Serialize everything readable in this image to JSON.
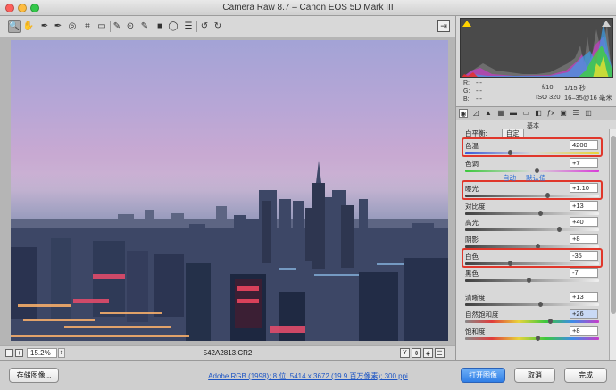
{
  "window": {
    "title": "Camera Raw 8.7 –  Canon EOS 5D Mark III"
  },
  "toolbar": {
    "tools": [
      {
        "name": "zoom-tool",
        "glyph": "🔍"
      },
      {
        "name": "hand-tool",
        "glyph": "✋"
      },
      {
        "name": "white-balance-tool",
        "glyph": "✒"
      },
      {
        "name": "color-sampler-tool",
        "glyph": "✒"
      },
      {
        "name": "target-adjust-tool",
        "glyph": "◎"
      },
      {
        "name": "crop-tool",
        "glyph": "⌗"
      },
      {
        "name": "straighten-tool",
        "glyph": "▭"
      },
      {
        "name": "spot-removal-tool",
        "glyph": "✎"
      },
      {
        "name": "red-eye-tool",
        "glyph": "⊙"
      },
      {
        "name": "adjustment-brush-tool",
        "glyph": "✎"
      },
      {
        "name": "graduated-filter-tool",
        "glyph": "■"
      },
      {
        "name": "radial-filter-tool",
        "glyph": "◯"
      },
      {
        "name": "preferences-tool",
        "glyph": "☰"
      },
      {
        "name": "rotate-left-tool",
        "glyph": "↺"
      },
      {
        "name": "rotate-right-tool",
        "glyph": "↻"
      }
    ],
    "export_glyph": "⇥"
  },
  "status": {
    "zoom_value": "15.2%",
    "zoom_minus": "−",
    "zoom_plus": "+",
    "stepper": "⇕",
    "filename": "542A2813.CR2"
  },
  "readout": {
    "r_label": "R:",
    "g_label": "G:",
    "b_label": "B:",
    "r_value": "---",
    "g_value": "---",
    "b_value": "---",
    "aperture": "f/10",
    "shutter": "1/15 秒",
    "iso": "ISO 320",
    "lens": "16–35@16 毫米"
  },
  "panel": {
    "section_title": "基本",
    "white_balance_label": "白平衡:",
    "white_balance_value": "自定",
    "auto_label": "自动",
    "default_label": "默认值",
    "rows": [
      {
        "key": "temp",
        "label": "色温",
        "value": "4200",
        "fraction": 0.33
      },
      {
        "key": "tint",
        "label": "色调",
        "value": "+7",
        "fraction": 0.53
      },
      {
        "key": "exposure",
        "label": "曝光",
        "value": "+1.10",
        "fraction": 0.61
      },
      {
        "key": "contrast",
        "label": "对比度",
        "value": "+13",
        "fraction": 0.56
      },
      {
        "key": "highlights",
        "label": "高光",
        "value": "+40",
        "fraction": 0.7
      },
      {
        "key": "shadows",
        "label": "阴影",
        "value": "+8",
        "fraction": 0.54
      },
      {
        "key": "whites",
        "label": "白色",
        "value": "-35",
        "fraction": 0.33
      },
      {
        "key": "blacks",
        "label": "黑色",
        "value": "-7",
        "fraction": 0.47
      },
      {
        "key": "clarity",
        "label": "清晰度",
        "value": "+13",
        "fraction": 0.56
      },
      {
        "key": "vibrance",
        "label": "自然饱和度",
        "value": "+26",
        "fraction": 0.63
      },
      {
        "key": "saturation",
        "label": "饱和度",
        "value": "+8",
        "fraction": 0.54
      }
    ]
  },
  "bottom": {
    "save_label": "存储图像...",
    "workflow_link": "Adobe RGB (1998); 8 位; 5414 x 3672 (19.9 百万像素); 300 ppi",
    "open_label": "打开图像",
    "cancel_label": "取消",
    "done_label": "完成"
  },
  "colors": {
    "highlight_box": "#e0372b",
    "primary_button": "#2f7ee6",
    "link": "#1d55c4"
  }
}
